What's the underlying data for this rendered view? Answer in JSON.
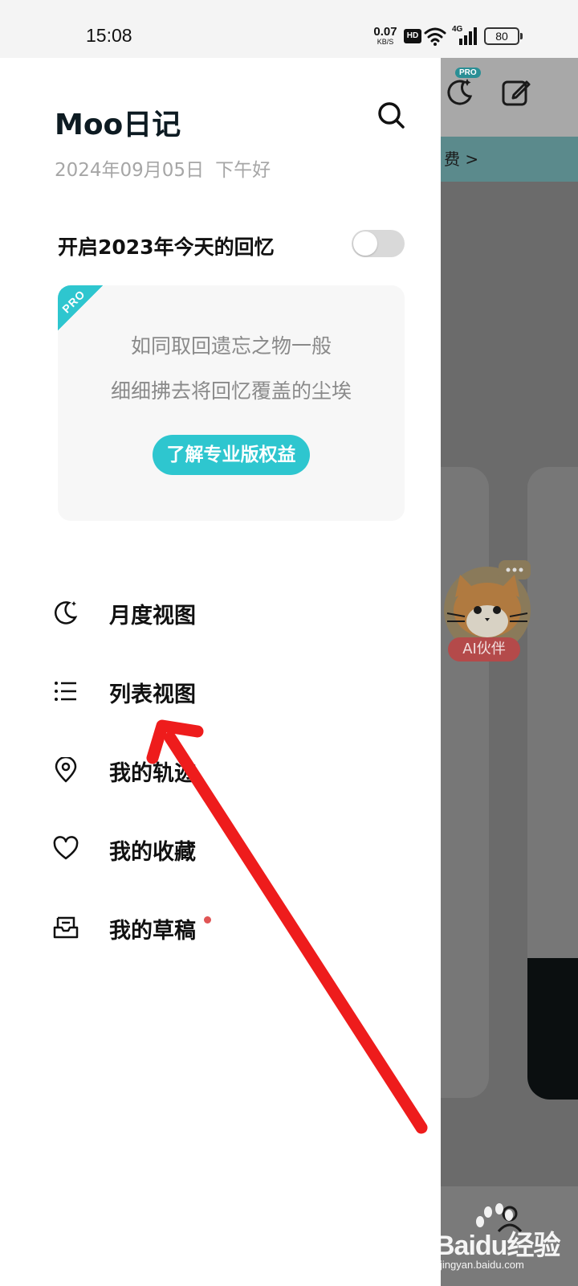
{
  "status_bar": {
    "time": "15:08",
    "net_speed_value": "0.07",
    "net_speed_unit": "KB/S",
    "hd": "HD",
    "network_type": "4G",
    "battery": "80"
  },
  "drawer": {
    "app_title": "Moo日记",
    "date": "2024年09月05日",
    "greeting": "下午好",
    "memory_toggle": {
      "label": "开启2023年今天的回忆",
      "enabled": false
    },
    "pro_card": {
      "badge": "PRO",
      "line1": "如同取回遗忘之物一般",
      "line2": "细细拂去将回忆覆盖的尘埃",
      "button_label": "了解专业版权益"
    },
    "menu": [
      {
        "id": "monthly",
        "label": "月度视图",
        "icon": "moon-icon"
      },
      {
        "id": "list",
        "label": "列表视图",
        "icon": "list-icon"
      },
      {
        "id": "trail",
        "label": "我的轨迹",
        "icon": "location-pin-icon"
      },
      {
        "id": "favorites",
        "label": "我的收藏",
        "icon": "heart-icon"
      },
      {
        "id": "drafts",
        "label": "我的草稿",
        "icon": "inbox-icon",
        "has_badge": true
      }
    ]
  },
  "background_app": {
    "pro_badge": "PRO",
    "banner_text": "费 >",
    "ai_label": "AI伙伴"
  },
  "watermark": {
    "brand": "Baidu经验",
    "url": "jingyan.baidu.com"
  },
  "colors": {
    "accent": "#2ec6cf",
    "annotation_arrow": "#ee1c1c",
    "draft_dot": "#e05555"
  }
}
